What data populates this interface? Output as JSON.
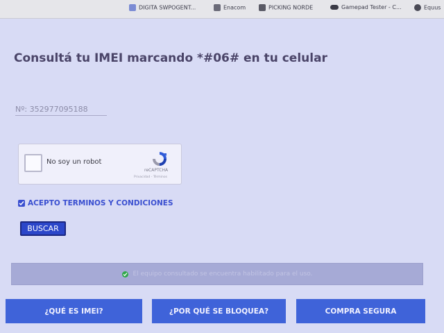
{
  "bookmarks": [
    {
      "label": "DIGITA SWPOGENT...",
      "icon": "bookmark-icon"
    },
    {
      "label": "Enacom",
      "icon": "enacom-icon"
    },
    {
      "label": "PICKING NORDE",
      "icon": "picking-icon"
    },
    {
      "label": "Gamepad Tester - C...",
      "icon": "gamepad-icon"
    },
    {
      "label": "Equus",
      "icon": "globe-icon"
    }
  ],
  "main": {
    "title": "Consultá tu IMEI marcando *#06# en tu celular",
    "imei_value": "Nº: 352977095188",
    "recaptcha": {
      "label": "No soy un robot",
      "brand": "reCAPTCHA",
      "links": "Privacidad - Términos"
    },
    "terms_label": "ACEPTO TERMINOS Y CONDICIONES",
    "terms_checked": true,
    "search_button": "BUSCAR",
    "status_message": "El equipo consultado se encuentra habilitado para el uso.",
    "status_color": "#2fa84a"
  },
  "nav": [
    {
      "label": "¿QUÉ ES IMEI?"
    },
    {
      "label": "¿POR QUÉ SE BLOQUEA?"
    },
    {
      "label": "COMPRA SEGURA"
    }
  ],
  "colors": {
    "accent": "#3f63d9",
    "button": "#2b46c9",
    "title": "#4a4468"
  }
}
